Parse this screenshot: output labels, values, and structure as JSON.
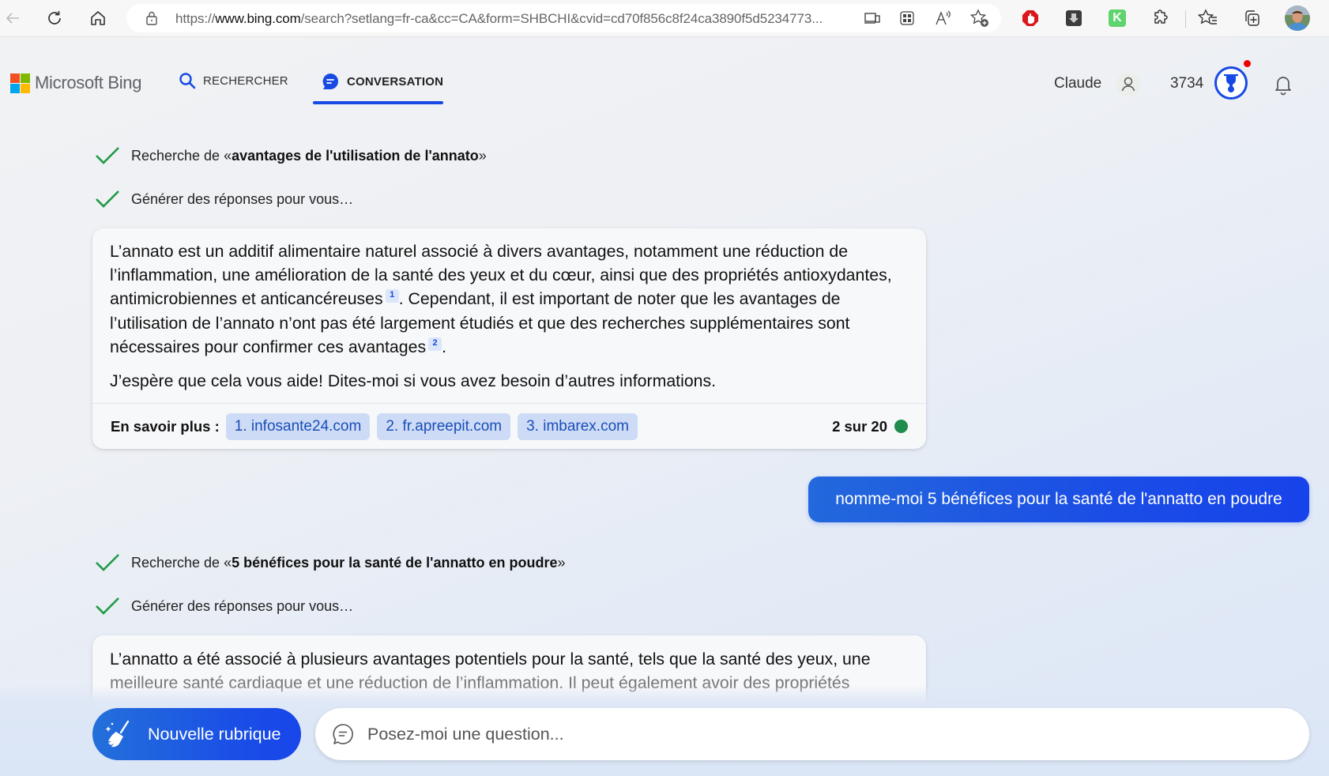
{
  "browser": {
    "url_prefix": "https://",
    "url_domain": "www.bing.com",
    "url_rest": "/search?setlang=fr-ca&cc=CA&form=SHBCHI&cvid=cd70f856c8f24ca3890f5d5234773...",
    "icons": [
      "back-icon",
      "refresh-icon",
      "home-icon",
      "lock-icon",
      "device-icon",
      "apps-icon",
      "read-aloud-icon",
      "add-favorite-icon",
      "adblock-icon",
      "download-extension-icon",
      "k-extension-icon",
      "extensions-icon",
      "favorites-icon",
      "collections-icon",
      "profile-avatar"
    ],
    "k_ext_label": "K"
  },
  "header": {
    "logo_text": "Microsoft Bing",
    "logo_colors": [
      "#f25022",
      "#7fba00",
      "#00a4ef",
      "#ffb900"
    ],
    "tabs": [
      {
        "label": "RECHERCHER",
        "icon": "search-icon",
        "active": false
      },
      {
        "label": "CONVERSATION",
        "icon": "chat-bubble-icon",
        "active": true
      }
    ],
    "user_name": "Claude",
    "points": "3734",
    "accent": "#174ae4"
  },
  "conversation": {
    "turn1": {
      "steps": [
        {
          "prefix": "Recherche de «",
          "bold": "avantages de l'utilisation de l'annato",
          "suffix": "»"
        },
        {
          "prefix": "Générer des réponses pour vous…",
          "bold": "",
          "suffix": ""
        }
      ],
      "answer": {
        "para1_part1": "L’annato est un additif alimentaire naturel associé à divers avantages, notamment une réduction de l’inflammation, une amélioration de la santé des yeux et du cœur, ainsi que des propriétés antioxydantes, antimicrobiennes et anticancéreuses",
        "cite1": "1",
        "para1_part2": ". Cependant, il est important de noter que les avantages de l’utilisation de l’annato n’ont pas été largement étudiés et que des recherches supplémentaires sont nécessaires pour confirmer ces avantages",
        "cite2": "2",
        "para1_part3": ".",
        "para2": "J’espère que cela vous aide! Dites-moi si vous avez besoin d’autres informations."
      },
      "footer": {
        "learn_more_label": "En savoir plus :",
        "sources": [
          "1. infosante24.com",
          "2. fr.apreepit.com",
          "3. imbarex.com"
        ],
        "counter": "2 sur 20",
        "status_color": "#1f8b4c"
      }
    },
    "user_message": "nomme-moi 5 bénéfices pour la santé de l'annatto en poudre",
    "turn2": {
      "steps": [
        {
          "prefix": "Recherche de «",
          "bold": "5 bénéfices pour la santé de l'annatto en poudre",
          "suffix": "»"
        },
        {
          "prefix": "Générer des réponses pour vous…",
          "bold": "",
          "suffix": ""
        }
      ],
      "answer": {
        "line1": "L’annatto a été associé à plusieurs avantages potentiels pour la santé, tels que la santé des yeux, une",
        "line2": "meilleure santé cardiaque et une réduction de l’inflammation. Il peut également avoir des propriétés"
      }
    }
  },
  "composer": {
    "new_topic_label": "Nouvelle rubrique",
    "input_placeholder": "Posez-moi une question...",
    "input_value": ""
  }
}
